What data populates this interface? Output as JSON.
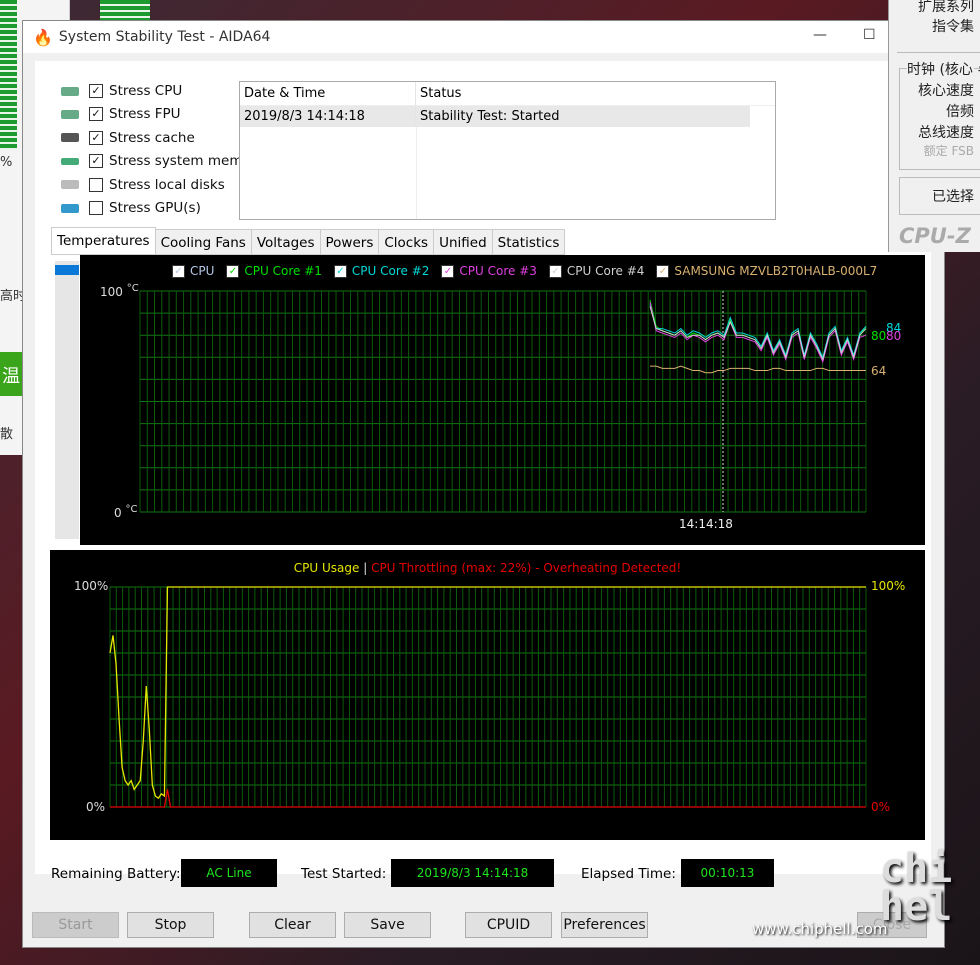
{
  "background": {
    "percent": "%",
    "text1": "高时",
    "button": "温",
    "text2": "散"
  },
  "window": {
    "title": "System Stability Test - AIDA64",
    "icon": "flame-icon",
    "minimize": "—",
    "maximize": "☐"
  },
  "stress": [
    {
      "label": "Stress CPU",
      "checked": true,
      "icon": "cpu-icon"
    },
    {
      "label": "Stress FPU",
      "checked": true,
      "icon": "fpu-icon"
    },
    {
      "label": "Stress cache",
      "checked": true,
      "icon": "cache-icon"
    },
    {
      "label": "Stress system memory",
      "checked": true,
      "icon": "memory-icon"
    },
    {
      "label": "Stress local disks",
      "checked": false,
      "icon": "disk-icon"
    },
    {
      "label": "Stress GPU(s)",
      "checked": false,
      "icon": "gpu-icon"
    }
  ],
  "log": {
    "headers": [
      "Date & Time",
      "Status"
    ],
    "rows": [
      [
        "2019/8/3 14:14:18",
        "Stability Test: Started"
      ]
    ]
  },
  "tabs": [
    "Temperatures",
    "Cooling Fans",
    "Voltages",
    "Powers",
    "Clocks",
    "Unified",
    "Statistics"
  ],
  "chart_data": [
    {
      "type": "line",
      "title": "",
      "ylim": [
        0,
        100
      ],
      "ytick_top": "100",
      "ytick_bottom": "0",
      "unit": "°C",
      "xtick": "14:14:18",
      "grid": true,
      "legend": [
        {
          "name": "CPU",
          "color": "#b4c8e6"
        },
        {
          "name": "CPU Core #1",
          "color": "#00e000"
        },
        {
          "name": "CPU Core #2",
          "color": "#00d8d8"
        },
        {
          "name": "CPU Core #3",
          "color": "#e040e0"
        },
        {
          "name": "CPU Core #4",
          "color": "#d0d0d0"
        },
        {
          "name": "SAMSUNG MZVLB2T0HALB-000L7",
          "color": "#d8b070"
        }
      ],
      "series": [
        {
          "name": "CPU Core #1",
          "values": [
            96,
            84,
            82,
            81,
            80,
            82,
            79,
            81,
            80,
            78,
            80,
            81,
            79,
            87,
            80,
            80,
            79,
            78,
            74,
            80,
            72,
            77,
            70,
            80,
            82,
            70,
            80,
            75,
            69,
            80,
            83,
            72,
            78,
            70,
            80,
            84
          ]
        },
        {
          "name": "CPU Core #2",
          "values": [
            94,
            83,
            83,
            82,
            81,
            83,
            80,
            82,
            81,
            79,
            81,
            82,
            80,
            88,
            81,
            81,
            80,
            79,
            75,
            81,
            73,
            78,
            71,
            81,
            83,
            71,
            81,
            76,
            70,
            81,
            84,
            73,
            79,
            71,
            81,
            84
          ]
        },
        {
          "name": "CPU Core #3",
          "values": [
            95,
            82,
            81,
            80,
            79,
            81,
            78,
            80,
            79,
            77,
            79,
            80,
            78,
            86,
            79,
            79,
            78,
            77,
            73,
            79,
            71,
            76,
            69,
            79,
            81,
            69,
            79,
            74,
            68,
            79,
            82,
            71,
            77,
            69,
            79,
            80
          ]
        },
        {
          "name": "CPU Core #4",
          "values": [
            93,
            83,
            82,
            81,
            80,
            82,
            79,
            80,
            80,
            78,
            80,
            81,
            79,
            86,
            80,
            80,
            79,
            78,
            74,
            80,
            72,
            77,
            70,
            80,
            82,
            70,
            80,
            75,
            69,
            80,
            83,
            72,
            78,
            70,
            80,
            83
          ]
        },
        {
          "name": "SAMSUNG MZVLB2T0HALB-000L7",
          "values": [
            66,
            66,
            65,
            65,
            65,
            66,
            65,
            64,
            64,
            63,
            63,
            64,
            64,
            65,
            65,
            65,
            65,
            64,
            64,
            64,
            65,
            65,
            64,
            64,
            64,
            64,
            64,
            65,
            65,
            64,
            64,
            64,
            64,
            64,
            64,
            64
          ]
        }
      ],
      "end_labels": [
        "84",
        "80",
        "80",
        "64"
      ]
    },
    {
      "type": "line",
      "title_usage": "CPU Usage",
      "separator": "|",
      "title_throttle": "CPU Throttling (max: 22%) - Overheating Detected!",
      "ylim": [
        0,
        100
      ],
      "ytick_top": "100%",
      "ytick_bottom": "0%",
      "grid": true,
      "usage": [
        [
          0,
          70
        ],
        [
          1,
          78
        ],
        [
          2,
          65
        ],
        [
          3,
          40
        ],
        [
          4,
          18
        ],
        [
          5,
          12
        ],
        [
          6,
          10
        ],
        [
          7,
          12
        ],
        [
          8,
          8
        ],
        [
          9,
          10
        ],
        [
          10,
          12
        ],
        [
          11,
          30
        ],
        [
          12,
          55
        ],
        [
          13,
          35
        ],
        [
          14,
          10
        ],
        [
          15,
          5
        ],
        [
          16,
          4
        ],
        [
          17,
          6
        ],
        [
          18,
          5
        ],
        [
          19,
          100
        ],
        [
          250,
          100
        ]
      ],
      "throttling": [
        [
          0,
          0
        ],
        [
          18,
          0
        ],
        [
          19,
          8
        ],
        [
          20,
          0
        ],
        [
          250,
          0
        ]
      ],
      "usage_color": "#e6e600",
      "throttle_color": "#e60000"
    }
  ],
  "status": {
    "battery_label": "Remaining Battery:",
    "battery": "AC Line",
    "started_label": "Test Started:",
    "started": "2019/8/3 14:14:18",
    "elapsed_label": "Elapsed Time:",
    "elapsed": "00:10:13"
  },
  "buttons": {
    "start": "Start",
    "stop": "Stop",
    "clear": "Clear",
    "save": "Save",
    "cpuid": "CPUID",
    "preferences": "Preferences",
    "close": "Close"
  },
  "cpuz": {
    "l1": "扩展系列",
    "l2": "指令集",
    "group": "时钟 (核心 #",
    "l3": "核心速度",
    "l4": "倍频",
    "l5": "总线速度",
    "l6": "额定 FSB",
    "l7": "已选择",
    "brand": "CPU-Z"
  },
  "watermark": {
    "url": "www.chiphell.com",
    "logo": "chip hell"
  }
}
